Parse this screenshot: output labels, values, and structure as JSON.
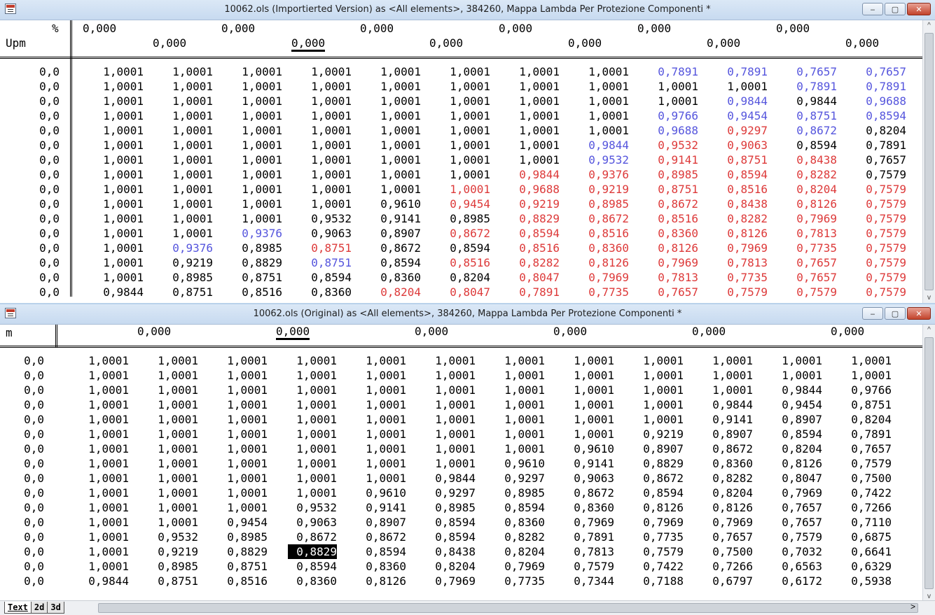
{
  "top_window": {
    "title": "10062.ols (Importierted Version) as <All elements>, 384260, Mappa Lambda Per Protezione Componenti *",
    "axis_x_label": "%",
    "axis_y_label": "Upm",
    "header_row1": [
      "0,000",
      "0,000",
      "0,000",
      "0,000",
      "0,000",
      "0,000"
    ],
    "header_row2": [
      "0,000",
      "0,000",
      "0,000",
      "0,000",
      "0,000",
      "0,000"
    ],
    "row_labels": [
      "0,0",
      "0,0",
      "0,0",
      "0,0",
      "0,0",
      "0,0",
      "0,0",
      "0,0",
      "0,0",
      "0,0",
      "0,0",
      "0,0",
      "0,0",
      "0,0",
      "0,0",
      "0,0"
    ],
    "rows": [
      [
        "1,0001",
        "1,0001",
        "1,0001",
        "1,0001",
        "1,0001",
        "1,0001",
        "1,0001",
        "1,0001",
        "0,7891",
        "0,7891",
        "0,7657",
        "0,7657"
      ],
      [
        "1,0001",
        "1,0001",
        "1,0001",
        "1,0001",
        "1,0001",
        "1,0001",
        "1,0001",
        "1,0001",
        "1,0001",
        "1,0001",
        "0,7891",
        "0,7891"
      ],
      [
        "1,0001",
        "1,0001",
        "1,0001",
        "1,0001",
        "1,0001",
        "1,0001",
        "1,0001",
        "1,0001",
        "1,0001",
        "0,9844",
        "0,9844",
        "0,9688"
      ],
      [
        "1,0001",
        "1,0001",
        "1,0001",
        "1,0001",
        "1,0001",
        "1,0001",
        "1,0001",
        "1,0001",
        "0,9766",
        "0,9454",
        "0,8751",
        "0,8594"
      ],
      [
        "1,0001",
        "1,0001",
        "1,0001",
        "1,0001",
        "1,0001",
        "1,0001",
        "1,0001",
        "1,0001",
        "0,9688",
        "0,9297",
        "0,8672",
        "0,8204"
      ],
      [
        "1,0001",
        "1,0001",
        "1,0001",
        "1,0001",
        "1,0001",
        "1,0001",
        "1,0001",
        "0,9844",
        "0,9532",
        "0,9063",
        "0,8594",
        "0,7891"
      ],
      [
        "1,0001",
        "1,0001",
        "1,0001",
        "1,0001",
        "1,0001",
        "1,0001",
        "1,0001",
        "0,9532",
        "0,9141",
        "0,8751",
        "0,8438",
        "0,7657"
      ],
      [
        "1,0001",
        "1,0001",
        "1,0001",
        "1,0001",
        "1,0001",
        "1,0001",
        "0,9844",
        "0,9376",
        "0,8985",
        "0,8594",
        "0,8282",
        "0,7579"
      ],
      [
        "1,0001",
        "1,0001",
        "1,0001",
        "1,0001",
        "1,0001",
        "1,0001",
        "0,9688",
        "0,9219",
        "0,8751",
        "0,8516",
        "0,8204",
        "0,7579"
      ],
      [
        "1,0001",
        "1,0001",
        "1,0001",
        "1,0001",
        "0,9610",
        "0,9454",
        "0,9219",
        "0,8985",
        "0,8672",
        "0,8438",
        "0,8126",
        "0,7579"
      ],
      [
        "1,0001",
        "1,0001",
        "1,0001",
        "0,9532",
        "0,9141",
        "0,8985",
        "0,8829",
        "0,8672",
        "0,8516",
        "0,8282",
        "0,7969",
        "0,7579"
      ],
      [
        "1,0001",
        "1,0001",
        "0,9376",
        "0,9063",
        "0,8907",
        "0,8672",
        "0,8594",
        "0,8516",
        "0,8360",
        "0,8126",
        "0,7813",
        "0,7579"
      ],
      [
        "1,0001",
        "0,9376",
        "0,8985",
        "0,8751",
        "0,8672",
        "0,8594",
        "0,8516",
        "0,8360",
        "0,8126",
        "0,7969",
        "0,7735",
        "0,7579"
      ],
      [
        "1,0001",
        "0,9219",
        "0,8829",
        "0,8751",
        "0,8594",
        "0,8516",
        "0,8282",
        "0,8126",
        "0,7969",
        "0,7813",
        "0,7657",
        "0,7579"
      ],
      [
        "1,0001",
        "0,8985",
        "0,8751",
        "0,8594",
        "0,8360",
        "0,8204",
        "0,8047",
        "0,7969",
        "0,7813",
        "0,7735",
        "0,7657",
        "0,7579"
      ],
      [
        "0,9844",
        "0,8751",
        "0,8516",
        "0,8360",
        "0,8204",
        "0,8047",
        "0,7891",
        "0,7735",
        "0,7657",
        "0,7579",
        "0,7579",
        "0,7579"
      ]
    ],
    "colors": [
      [
        "k",
        "k",
        "k",
        "k",
        "k",
        "k",
        "k",
        "k",
        "b",
        "b",
        "b",
        "b"
      ],
      [
        "k",
        "k",
        "k",
        "k",
        "k",
        "k",
        "k",
        "k",
        "k",
        "k",
        "b",
        "b"
      ],
      [
        "k",
        "k",
        "k",
        "k",
        "k",
        "k",
        "k",
        "k",
        "k",
        "b",
        "k",
        "b"
      ],
      [
        "k",
        "k",
        "k",
        "k",
        "k",
        "k",
        "k",
        "k",
        "b",
        "b",
        "b",
        "b"
      ],
      [
        "k",
        "k",
        "k",
        "k",
        "k",
        "k",
        "k",
        "k",
        "b",
        "r",
        "b",
        "k"
      ],
      [
        "k",
        "k",
        "k",
        "k",
        "k",
        "k",
        "k",
        "b",
        "r",
        "r",
        "k",
        "k"
      ],
      [
        "k",
        "k",
        "k",
        "k",
        "k",
        "k",
        "k",
        "b",
        "r",
        "r",
        "r",
        "k"
      ],
      [
        "k",
        "k",
        "k",
        "k",
        "k",
        "k",
        "r",
        "r",
        "r",
        "r",
        "r",
        "k"
      ],
      [
        "k",
        "k",
        "k",
        "k",
        "k",
        "r",
        "r",
        "r",
        "r",
        "r",
        "r",
        "r"
      ],
      [
        "k",
        "k",
        "k",
        "k",
        "k",
        "r",
        "r",
        "r",
        "r",
        "r",
        "r",
        "r"
      ],
      [
        "k",
        "k",
        "k",
        "k",
        "k",
        "k",
        "r",
        "r",
        "r",
        "r",
        "r",
        "r"
      ],
      [
        "k",
        "k",
        "b",
        "k",
        "k",
        "r",
        "r",
        "r",
        "r",
        "r",
        "r",
        "r"
      ],
      [
        "k",
        "b",
        "k",
        "r",
        "k",
        "k",
        "r",
        "r",
        "r",
        "r",
        "r",
        "r"
      ],
      [
        "k",
        "k",
        "k",
        "b",
        "k",
        "r",
        "r",
        "r",
        "r",
        "r",
        "r",
        "r"
      ],
      [
        "k",
        "k",
        "k",
        "k",
        "k",
        "k",
        "r",
        "r",
        "r",
        "r",
        "r",
        "r"
      ],
      [
        "k",
        "k",
        "k",
        "k",
        "r",
        "r",
        "r",
        "r",
        "r",
        "r",
        "r",
        "r"
      ]
    ]
  },
  "bottom_window": {
    "title": "10062.ols (Original) as <All elements>, 384260, Mappa Lambda Per Protezione Componenti *",
    "axis_y_label": "m",
    "header_row": [
      "0,000",
      "0,000",
      "0,000",
      "0,000",
      "0,000",
      "0,000"
    ],
    "row_labels": [
      "0,0",
      "0,0",
      "0,0",
      "0,0",
      "0,0",
      "0,0",
      "0,0",
      "0,0",
      "0,0",
      "0,0",
      "0,0",
      "0,0",
      "0,0",
      "0,0",
      "0,0",
      "0,0"
    ],
    "rows": [
      [
        "1,0001",
        "1,0001",
        "1,0001",
        "1,0001",
        "1,0001",
        "1,0001",
        "1,0001",
        "1,0001",
        "1,0001",
        "1,0001",
        "1,0001",
        "1,0001"
      ],
      [
        "1,0001",
        "1,0001",
        "1,0001",
        "1,0001",
        "1,0001",
        "1,0001",
        "1,0001",
        "1,0001",
        "1,0001",
        "1,0001",
        "1,0001",
        "1,0001"
      ],
      [
        "1,0001",
        "1,0001",
        "1,0001",
        "1,0001",
        "1,0001",
        "1,0001",
        "1,0001",
        "1,0001",
        "1,0001",
        "1,0001",
        "0,9844",
        "0,9766"
      ],
      [
        "1,0001",
        "1,0001",
        "1,0001",
        "1,0001",
        "1,0001",
        "1,0001",
        "1,0001",
        "1,0001",
        "1,0001",
        "0,9844",
        "0,9454",
        "0,8751"
      ],
      [
        "1,0001",
        "1,0001",
        "1,0001",
        "1,0001",
        "1,0001",
        "1,0001",
        "1,0001",
        "1,0001",
        "1,0001",
        "0,9141",
        "0,8907",
        "0,8204"
      ],
      [
        "1,0001",
        "1,0001",
        "1,0001",
        "1,0001",
        "1,0001",
        "1,0001",
        "1,0001",
        "1,0001",
        "0,9219",
        "0,8907",
        "0,8594",
        "0,7891"
      ],
      [
        "1,0001",
        "1,0001",
        "1,0001",
        "1,0001",
        "1,0001",
        "1,0001",
        "1,0001",
        "0,9610",
        "0,8907",
        "0,8672",
        "0,8204",
        "0,7657"
      ],
      [
        "1,0001",
        "1,0001",
        "1,0001",
        "1,0001",
        "1,0001",
        "1,0001",
        "0,9610",
        "0,9141",
        "0,8829",
        "0,8360",
        "0,8126",
        "0,7579"
      ],
      [
        "1,0001",
        "1,0001",
        "1,0001",
        "1,0001",
        "1,0001",
        "0,9844",
        "0,9297",
        "0,9063",
        "0,8672",
        "0,8282",
        "0,8047",
        "0,7500"
      ],
      [
        "1,0001",
        "1,0001",
        "1,0001",
        "1,0001",
        "0,9610",
        "0,9297",
        "0,8985",
        "0,8672",
        "0,8594",
        "0,8204",
        "0,7969",
        "0,7422"
      ],
      [
        "1,0001",
        "1,0001",
        "1,0001",
        "0,9532",
        "0,9141",
        "0,8985",
        "0,8594",
        "0,8360",
        "0,8126",
        "0,8126",
        "0,7657",
        "0,7266"
      ],
      [
        "1,0001",
        "1,0001",
        "0,9454",
        "0,9063",
        "0,8907",
        "0,8594",
        "0,8360",
        "0,7969",
        "0,7969",
        "0,7969",
        "0,7657",
        "0,7110"
      ],
      [
        "1,0001",
        "0,9532",
        "0,8985",
        "0,8672",
        "0,8672",
        "0,8594",
        "0,8282",
        "0,7891",
        "0,7735",
        "0,7657",
        "0,7579",
        "0,6875"
      ],
      [
        "1,0001",
        "0,9219",
        "0,8829",
        "0,8829",
        "0,8594",
        "0,8438",
        "0,8204",
        "0,7813",
        "0,7579",
        "0,7500",
        "0,7032",
        "0,6641"
      ],
      [
        "1,0001",
        "0,8985",
        "0,8751",
        "0,8594",
        "0,8360",
        "0,8204",
        "0,7969",
        "0,7579",
        "0,7422",
        "0,7266",
        "0,6563",
        "0,6329"
      ],
      [
        "0,9844",
        "0,8751",
        "0,8516",
        "0,8360",
        "0,8126",
        "0,7969",
        "0,7735",
        "0,7344",
        "0,7188",
        "0,6797",
        "0,6172",
        "0,5938"
      ]
    ],
    "selected_cell": {
      "row": 13,
      "col": 3
    },
    "tabs": [
      "Text",
      "2d",
      "3d"
    ]
  },
  "window_buttons": {
    "minimize": "‒",
    "maximize": "▢",
    "close": "✕"
  },
  "scroll": {
    "left": "<",
    "right": ">",
    "up": "^",
    "down": "v"
  }
}
